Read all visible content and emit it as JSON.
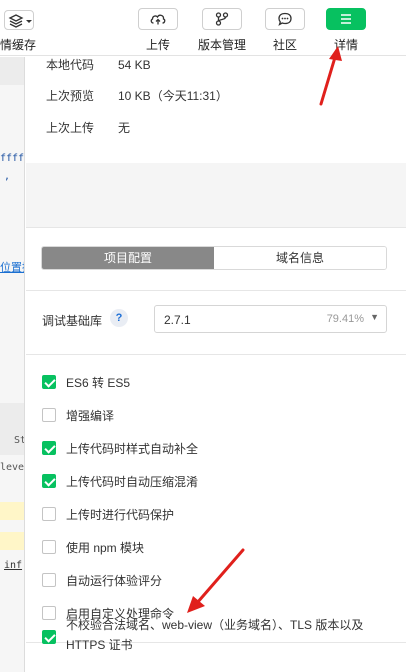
{
  "toolbar": {
    "layers_label": "情缓存",
    "buttons": [
      {
        "label": "上传",
        "icon": "cloud-upload-icon"
      },
      {
        "label": "版本管理",
        "icon": "branch-icon"
      },
      {
        "label": "社区",
        "icon": "chat-bubble-icon"
      },
      {
        "label": "详情",
        "icon": "menu-icon"
      }
    ]
  },
  "editor": {
    "code_line_1": "ffff'",
    "code_line_2": ",",
    "link_text": "位置招",
    "tab_text": "St",
    "level_text": "level",
    "info_text": "inf"
  },
  "info": {
    "rows": [
      {
        "key": "本地代码",
        "value": "54 KB"
      },
      {
        "key": "上次预览",
        "value": "10 KB（今天11:31）"
      },
      {
        "key": "上次上传",
        "value": "无"
      }
    ]
  },
  "tabs": {
    "project_config": "项目配置",
    "domain_info": "域名信息"
  },
  "base_lib": {
    "label": "调试基础库",
    "help": "?",
    "version": "2.7.1",
    "coverage": "79.41%"
  },
  "options": [
    {
      "label": "ES6 转 ES5",
      "checked": true
    },
    {
      "label": "增强编译",
      "checked": false
    },
    {
      "label": "上传代码时样式自动补全",
      "checked": true
    },
    {
      "label": "上传代码时自动压缩混淆",
      "checked": true
    },
    {
      "label": "上传时进行代码保护",
      "checked": false
    },
    {
      "label": "使用 npm 模块",
      "checked": false
    },
    {
      "label": "自动运行体验评分",
      "checked": false
    },
    {
      "label": "启用自定义处理命令",
      "checked": false
    }
  ],
  "last_option": {
    "label": "不校验合法域名、web-view（业务域名）、TLS 版本以及 HTTPS 证书",
    "checked": true
  },
  "colors": {
    "accent": "#07c160",
    "annotation_arrow": "#e0201c",
    "segment_active": "#888888"
  }
}
